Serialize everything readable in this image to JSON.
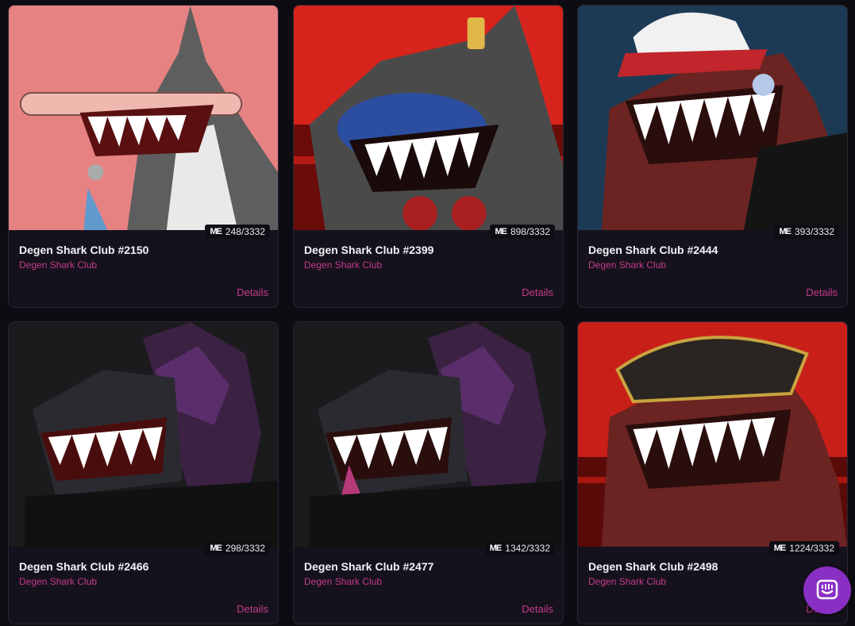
{
  "cards": [
    {
      "title": "Degen Shark Club #2150",
      "collection": "Degen Shark Club",
      "rank": "248/3332",
      "details": "Details",
      "bg": "#e78283",
      "accent": "#5e5e5e",
      "hat": "none",
      "art": "shark-2150"
    },
    {
      "title": "Degen Shark Club #2399",
      "collection": "Degen Shark Club",
      "rank": "898/3332",
      "details": "Details",
      "bg": "#d6241c",
      "accent": "#4a4a4a",
      "hat": "none",
      "art": "shark-2399"
    },
    {
      "title": "Degen Shark Club #2444",
      "collection": "Degen Shark Club",
      "rank": "393/3332",
      "details": "Details",
      "bg": "#1d3a55",
      "accent": "#6b2421",
      "hat": "cap",
      "art": "shark-2444"
    },
    {
      "title": "Degen Shark Club #2466",
      "collection": "Degen Shark Club",
      "rank": "298/3332",
      "details": "Details",
      "bg": "#1b1b1d",
      "accent": "#2d2d35",
      "hat": "hood",
      "art": "shark-2466"
    },
    {
      "title": "Degen Shark Club #2477",
      "collection": "Degen Shark Club",
      "rank": "1342/3332",
      "details": "Details",
      "bg": "#1b1b1d",
      "accent": "#2d2d35",
      "hat": "hood",
      "art": "shark-2477"
    },
    {
      "title": "Degen Shark Club #2498",
      "collection": "Degen Shark Club",
      "rank": "1224/3332",
      "details": "Details",
      "bg": "#c81f18",
      "accent": "#6b2421",
      "hat": "pirate",
      "art": "shark-2498"
    }
  ],
  "marketplace_icon": "magic-eden-icon",
  "chat": {
    "icon": "chat-icon",
    "color": "#8a2fc4"
  }
}
